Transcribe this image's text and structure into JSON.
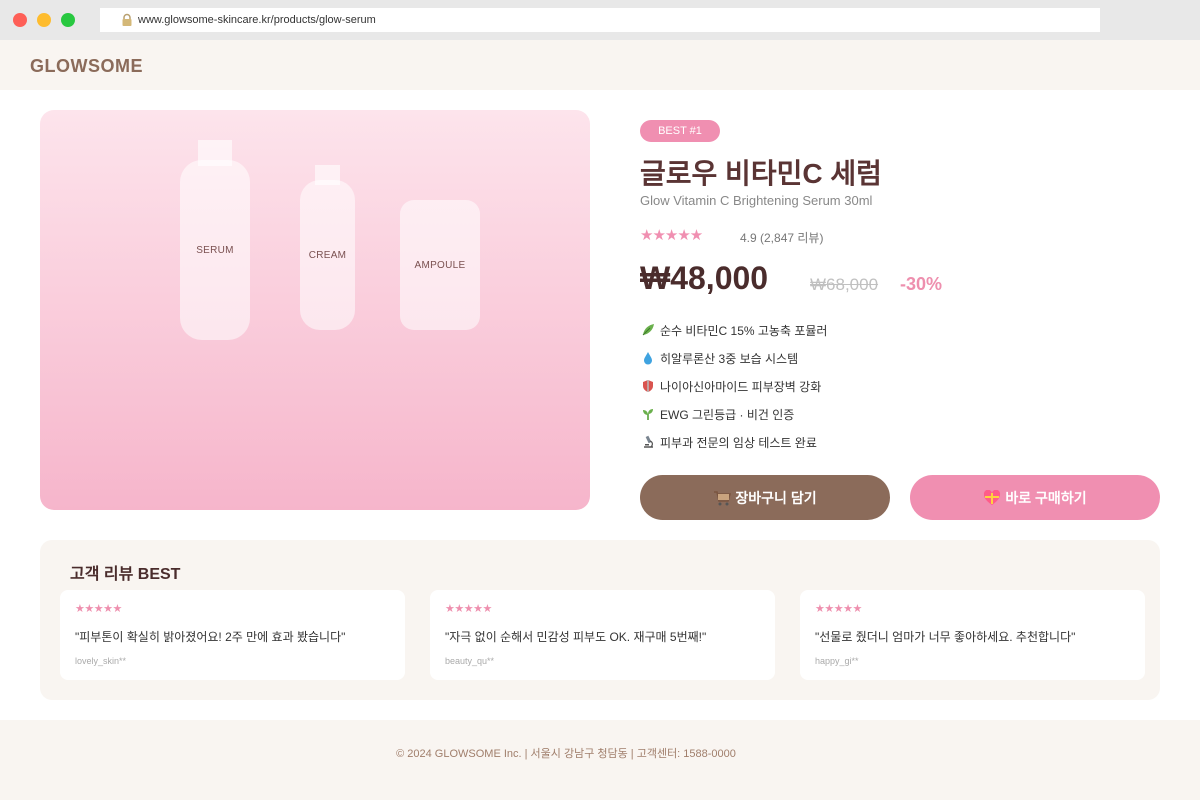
{
  "browser": {
    "url": "www.glowsome-skincare.kr/products/glow-serum"
  },
  "header": {
    "logo": "GLOWSOME"
  },
  "product_image": {
    "labels": [
      "SERUM",
      "CREAM",
      "AMPOULE"
    ]
  },
  "product": {
    "badge": "BEST #1",
    "title": "글로우 비타민C 세럼",
    "subtitle": "Glow Vitamin C Brightening Serum 30ml",
    "stars": "★★★★★",
    "rating_value": 4.9,
    "rating_text": "4.9 (2,847 리뷰)",
    "price": "₩48,000",
    "original_price": "₩68,000",
    "discount": "-30%",
    "features": [
      {
        "icon": "herb-icon",
        "text": "순수 비타민C 15% 고농축 포뮬러"
      },
      {
        "icon": "droplet-icon",
        "text": "히알루론산 3중 보습 시스템"
      },
      {
        "icon": "shield-icon",
        "text": "나이아신아마이드 피부장벽 강화"
      },
      {
        "icon": "seedling-icon",
        "text": "EWG 그린등급 · 비건 인증"
      },
      {
        "icon": "microscope-icon",
        "text": "피부과 전문의 임상 테스트 완료"
      }
    ]
  },
  "actions": {
    "cart_label": "장바구니 담기",
    "buy_label": "바로 구매하기"
  },
  "reviews": {
    "title": "고객 리뷰 BEST",
    "items": [
      {
        "stars": "★★★★★",
        "text": "\"피부톤이 확실히 밝아졌어요! 2주 만에 효과 봤습니다\"",
        "author": "lovely_skin**"
      },
      {
        "stars": "★★★★★",
        "text": "\"자극 없이 순해서 민감성 피부도 OK. 재구매 5번째!\"",
        "author": "beauty_qu**"
      },
      {
        "stars": "★★★★★",
        "text": "\"선물로 줬더니 엄마가 너무 좋아하세요. 추천합니다\"",
        "author": "happy_gi**"
      }
    ]
  },
  "footer": {
    "text": "© 2024 GLOWSOME Inc. | 서울시 강남구 청담동 | 고객센터: 1588-0000"
  },
  "colors": {
    "accent_pink": "#f08fb1",
    "brand_brown": "#8b6b5a",
    "title_brown": "#5a3434",
    "cream_bg": "#f9f5f1"
  }
}
